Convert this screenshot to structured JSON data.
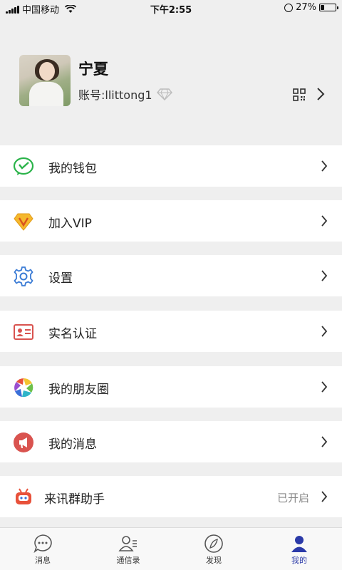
{
  "status_bar": {
    "carrier": "中国移动",
    "time": "下午2:55",
    "battery": "27%"
  },
  "profile": {
    "nickname": "宁夏",
    "account": "账号:llittong1"
  },
  "menu": [
    {
      "label": "我的钱包",
      "icon": "wallet-icon"
    },
    {
      "label": "加入VIP",
      "icon": "vip-icon"
    },
    {
      "label": "设置",
      "icon": "gear-icon"
    },
    {
      "label": "实名认证",
      "icon": "id-card-icon"
    },
    {
      "label": "我的朋友圈",
      "icon": "aperture-icon"
    },
    {
      "label": "我的消息",
      "icon": "megaphone-icon"
    },
    {
      "label": "来讯群助手",
      "icon": "bot-icon",
      "status": "已开启"
    }
  ],
  "tabs": [
    {
      "label": "消息",
      "icon": "chat-bubble-icon"
    },
    {
      "label": "通信录",
      "icon": "contacts-icon"
    },
    {
      "label": "发现",
      "icon": "compass-icon"
    },
    {
      "label": "我的",
      "icon": "person-icon",
      "active": true
    }
  ],
  "colors": {
    "active_tab": "#2b3aa8",
    "background": "#efefef"
  }
}
